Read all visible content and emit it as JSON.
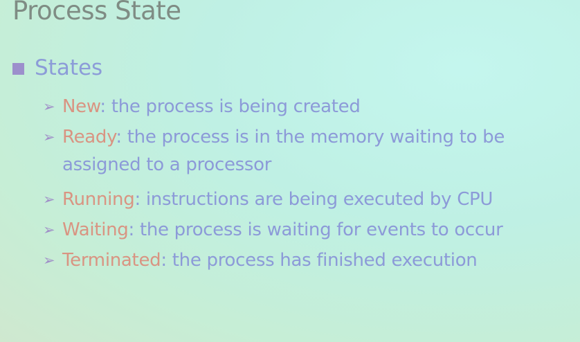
{
  "title": "Process State",
  "level1": {
    "label": "States"
  },
  "items": [
    {
      "term": "New",
      "text": ": the process is being created"
    },
    {
      "term": "Ready",
      "text": ": the process is in the memory waiting to be assigned to a processor"
    },
    {
      "term": "Running",
      "text": ": instructions are being executed by CPU"
    },
    {
      "term": "Waiting",
      "text": ": the process is waiting for events to occur"
    },
    {
      "term": "Terminated",
      "text": ": the process has finished execution"
    }
  ],
  "colors": {
    "title": "#7f8c84",
    "body": "#8c9ad8",
    "term": "#d99482",
    "bullet": "#9c8fcc"
  },
  "icons": {
    "level1": "square-bullet-icon",
    "level2": "arrow-bullet-icon"
  }
}
